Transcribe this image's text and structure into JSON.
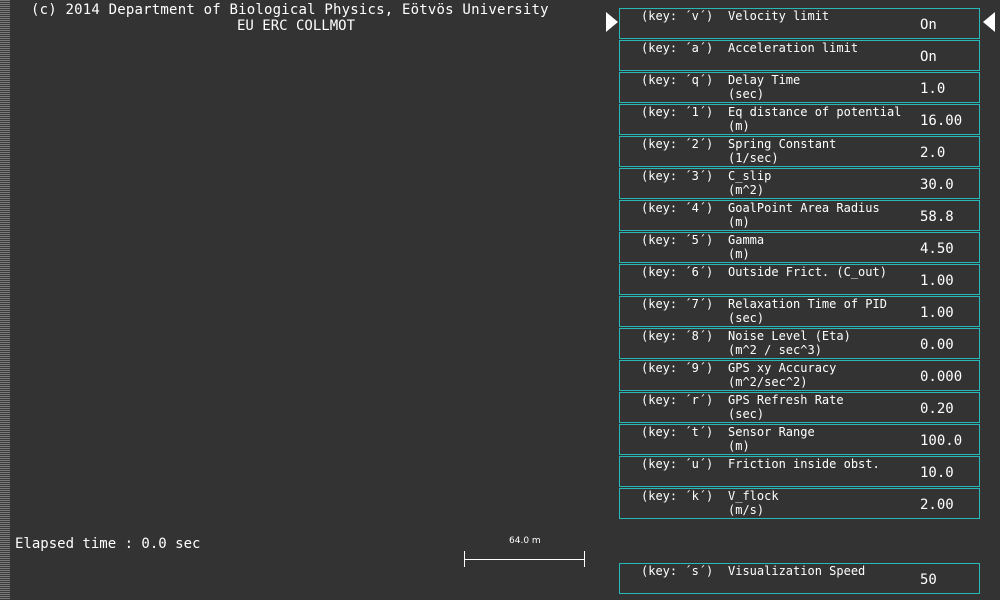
{
  "header": {
    "credit_line1": "(c) 2014 Department of Biological Physics, Eötvös University",
    "credit_line2": "EU ERC COLLMOT"
  },
  "status": {
    "elapsed_time": "Elapsed time : 0.0 sec"
  },
  "scale": {
    "label": "64.0 m"
  },
  "colors": {
    "background": "#333333",
    "panel_border": "#28b8b8",
    "text": "#ffffff"
  },
  "params": [
    {
      "key": "(key: ´v´)",
      "name": "Velocity limit",
      "unit": "",
      "value": "On"
    },
    {
      "key": "(key: ´a´)",
      "name": "Acceleration limit",
      "unit": "",
      "value": "On"
    },
    {
      "key": "(key: ´q´)",
      "name": "Delay Time",
      "unit": "(sec)",
      "value": "1.0"
    },
    {
      "key": "(key: ´1´)",
      "name": "Eq distance of potential",
      "unit": "(m)",
      "value": "16.00"
    },
    {
      "key": "(key: ´2´)",
      "name": "Spring Constant",
      "unit": "(1/sec)",
      "value": "2.0"
    },
    {
      "key": "(key: ´3´)",
      "name": "C_slip",
      "unit": "(m^2)",
      "value": "30.0"
    },
    {
      "key": "(key: ´4´)",
      "name": "GoalPoint Area Radius",
      "unit": "(m)",
      "value": "58.8"
    },
    {
      "key": "(key: ´5´)",
      "name": "Gamma",
      "unit": "(m)",
      "value": "4.50"
    },
    {
      "key": "(key: ´6´)",
      "name": "Outside Frict. (C_out)",
      "unit": "",
      "value": "1.00"
    },
    {
      "key": "(key: ´7´)",
      "name": "Relaxation Time of PID",
      "unit": "(sec)",
      "value": "1.00"
    },
    {
      "key": "(key: ´8´)",
      "name": "Noise Level (Eta)",
      "unit": "(m^2 / sec^3)",
      "value": "0.00"
    },
    {
      "key": "(key: ´9´)",
      "name": "GPS xy Accuracy",
      "unit": "(m^2/sec^2)",
      "value": "0.000"
    },
    {
      "key": "(key: ´r´)",
      "name": "GPS Refresh Rate",
      "unit": "(sec)",
      "value": "0.20"
    },
    {
      "key": "(key: ´t´)",
      "name": "Sensor Range",
      "unit": "(m)",
      "value": "100.0"
    },
    {
      "key": "(key: ´u´)",
      "name": "Friction inside obst.",
      "unit": "",
      "value": "10.0"
    },
    {
      "key": "(key: ´k´)",
      "name": "V_flock",
      "unit": "(m/s)",
      "value": "2.00"
    }
  ],
  "visualization": {
    "key": "(key: ´s´)",
    "name": "Visualization Speed",
    "value": "50"
  }
}
